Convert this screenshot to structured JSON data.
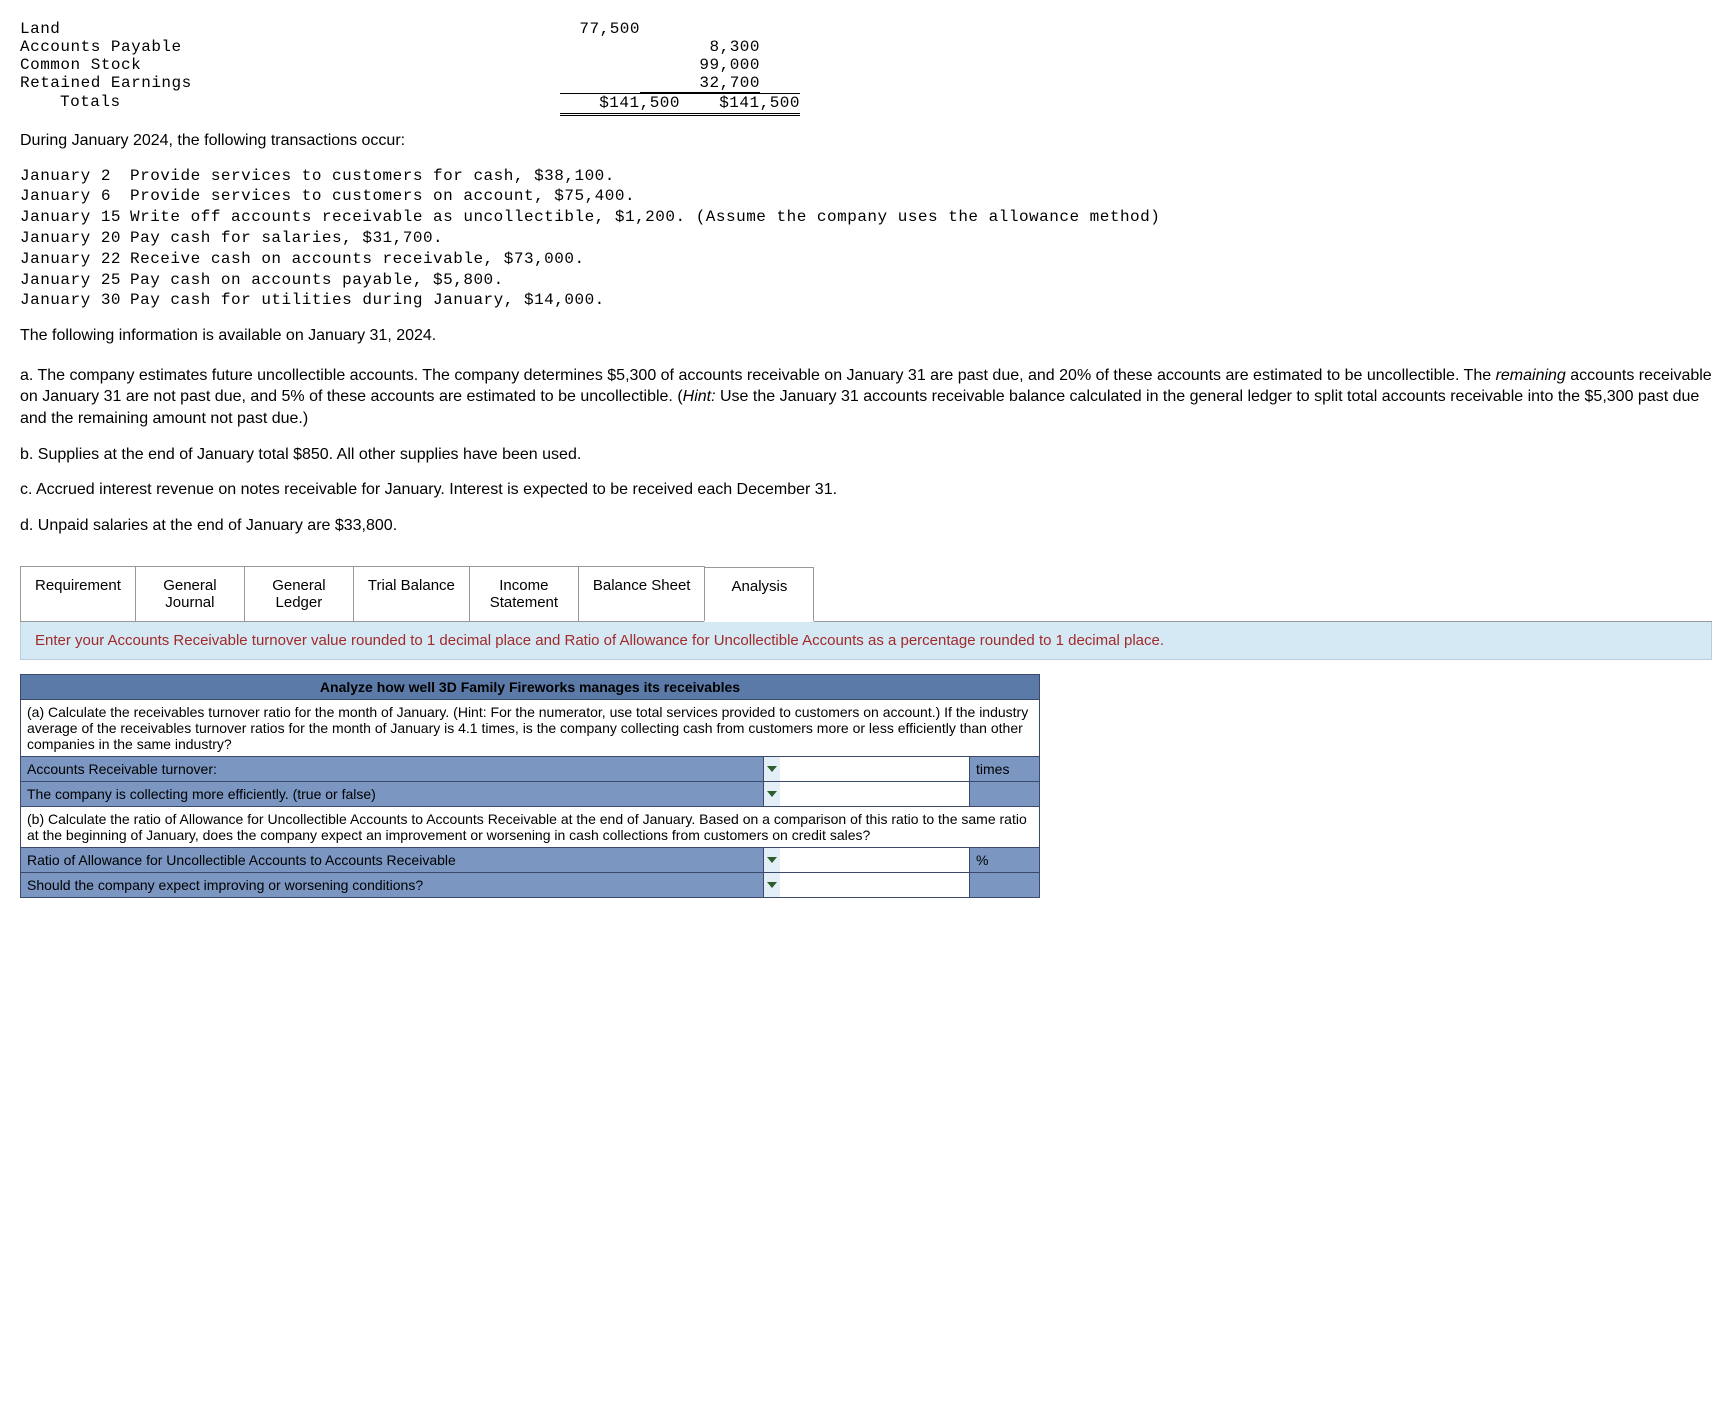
{
  "ledger": {
    "rows": [
      {
        "name": "Land",
        "debit": "77,500",
        "credit": ""
      },
      {
        "name": "Accounts Payable",
        "debit": "",
        "credit": "8,300"
      },
      {
        "name": "Common Stock",
        "debit": "",
        "credit": "99,000"
      },
      {
        "name": "Retained Earnings",
        "debit": "",
        "credit": "32,700"
      }
    ],
    "totals_label": "Totals",
    "totals_debit": "$141,500",
    "totals_credit": "$141,500"
  },
  "intro": "During January 2024, the following transactions occur:",
  "transactions": [
    {
      "date": "January 2",
      "desc": "Provide services to customers for cash, $38,100."
    },
    {
      "date": "January 6",
      "desc": "Provide services to customers on account, $75,400."
    },
    {
      "date": "January 15",
      "desc": "Write off accounts receivable as uncollectible, $1,200. (Assume the company uses the allowance method)"
    },
    {
      "date": "January 20",
      "desc": "Pay cash for salaries, $31,700."
    },
    {
      "date": "January 22",
      "desc": "Receive cash on accounts receivable, $73,000."
    },
    {
      "date": "January 25",
      "desc": "Pay cash on accounts payable, $5,800."
    },
    {
      "date": "January 30",
      "desc": "Pay cash for utilities during January, $14,000."
    }
  ],
  "info_heading": "The following information is available on January 31, 2024.",
  "info_items": {
    "a": "a. The company estimates future uncollectible accounts. The company determines $5,300 of accounts receivable on January 31 are past due, and 20% of these accounts are estimated to be uncollollectible. The remaining accounts receivable on January 31 are not past due, and 5% of these accounts are estimated to be uncollectible. (Hint: Use the January 31 accounts receivable balance calculated in the general ledger to split total accounts receivable into the $5,300 past due and the remaining amount not past due.)",
    "a_pre": "a. The company estimates future uncollectible accounts. The company determines $5,300 of accounts receivable on January 31 are past due, and 20% of these accounts are estimated to be uncollectible. The ",
    "a_em": "remaining",
    "a_post": " accounts receivable on January 31 are not past due, and 5% of these accounts are estimated to be uncollectible. (",
    "a_hint_label": "Hint:",
    "a_hint_text": " Use the January 31 accounts receivable balance calculated in the general ledger to split total accounts receivable into the $5,300 past due and the remaining amount not past due.)",
    "b": "b. Supplies at the end of January total $850. All other supplies have been used.",
    "c": "c. Accrued interest revenue on notes receivable for January. Interest is expected to be received each December 31.",
    "d": "d. Unpaid salaries at the end of January are $33,800."
  },
  "tabs": {
    "requirement": "Requirement",
    "journal": "General\nJournal",
    "ledger": "General\nLedger",
    "trial": "Trial Balance",
    "income": "Income\nStatement",
    "balance": "Balance Sheet",
    "analysis": "Analysis"
  },
  "instruction": "Enter your Accounts Receivable turnover value rounded to 1 decimal place and Ratio of Allowance for Uncollectible Accounts as a percentage rounded to 1 decimal place.",
  "panel": {
    "title": "Analyze how well 3D Family Fireworks manages its receivables",
    "qa_text": "(a) Calculate the receivables turnover ratio for the month of January. (Hint: For the numerator, use total services provided to customers on account.) If the industry average of the receivables turnover ratios for the month of January is 4.1 times, is the company collecting cash from customers more or less efficiently than other companies in the same industry?",
    "ar_turnover_label": "Accounts Receivable turnover:",
    "times_unit": "times",
    "efficient_label": "The company is collecting more efficiently. (true or false)",
    "qb_text": "(b) Calculate the ratio of Allowance for Uncollectible Accounts to Accounts Receivable at the end of January. Based on a comparison of this ratio to the same ratio at the beginning of January, does the company expect an improvement or worsening in cash collections from customers on credit sales?",
    "ratio_label": "Ratio of Allowance for Uncollectible Accounts to Accounts Receivable",
    "pct_unit": "%",
    "expect_label": "Should the company expect improving or worsening conditions?"
  }
}
